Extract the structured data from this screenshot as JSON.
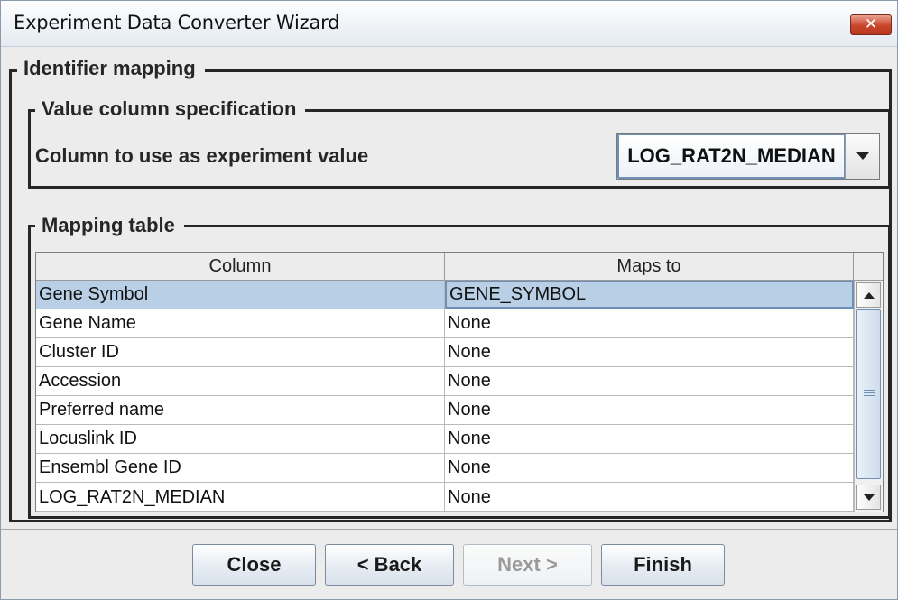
{
  "window": {
    "title": "Experiment Data Converter Wizard",
    "close_symbol": "✕"
  },
  "identifier_mapping": {
    "legend": "Identifier mapping"
  },
  "value_column": {
    "legend": "Value column specification",
    "label": "Column to use as experiment value",
    "selected": "LOG_RAT2N_MEDIAN",
    "dropdown_icon": "chevron-down-icon"
  },
  "mapping": {
    "legend": "Mapping table",
    "columns": [
      "Column",
      "Maps to"
    ],
    "rows": [
      {
        "column": "Gene Symbol",
        "maps_to": "GENE_SYMBOL"
      },
      {
        "column": "Gene Name",
        "maps_to": "None"
      },
      {
        "column": "Cluster ID",
        "maps_to": "None"
      },
      {
        "column": "Accession",
        "maps_to": "None"
      },
      {
        "column": "Preferred name",
        "maps_to": "None"
      },
      {
        "column": "Locuslink ID",
        "maps_to": "None"
      },
      {
        "column": "Ensembl Gene ID",
        "maps_to": "None"
      },
      {
        "column": "LOG_RAT2N_MEDIAN",
        "maps_to": "None"
      }
    ],
    "selected_row": 0
  },
  "buttons": {
    "close": "Close",
    "back": "< Back",
    "next": "Next >",
    "finish": "Finish"
  },
  "colors": {
    "selection": "#b8cfe5",
    "border": "#262626",
    "close_button": "#c9452a"
  }
}
